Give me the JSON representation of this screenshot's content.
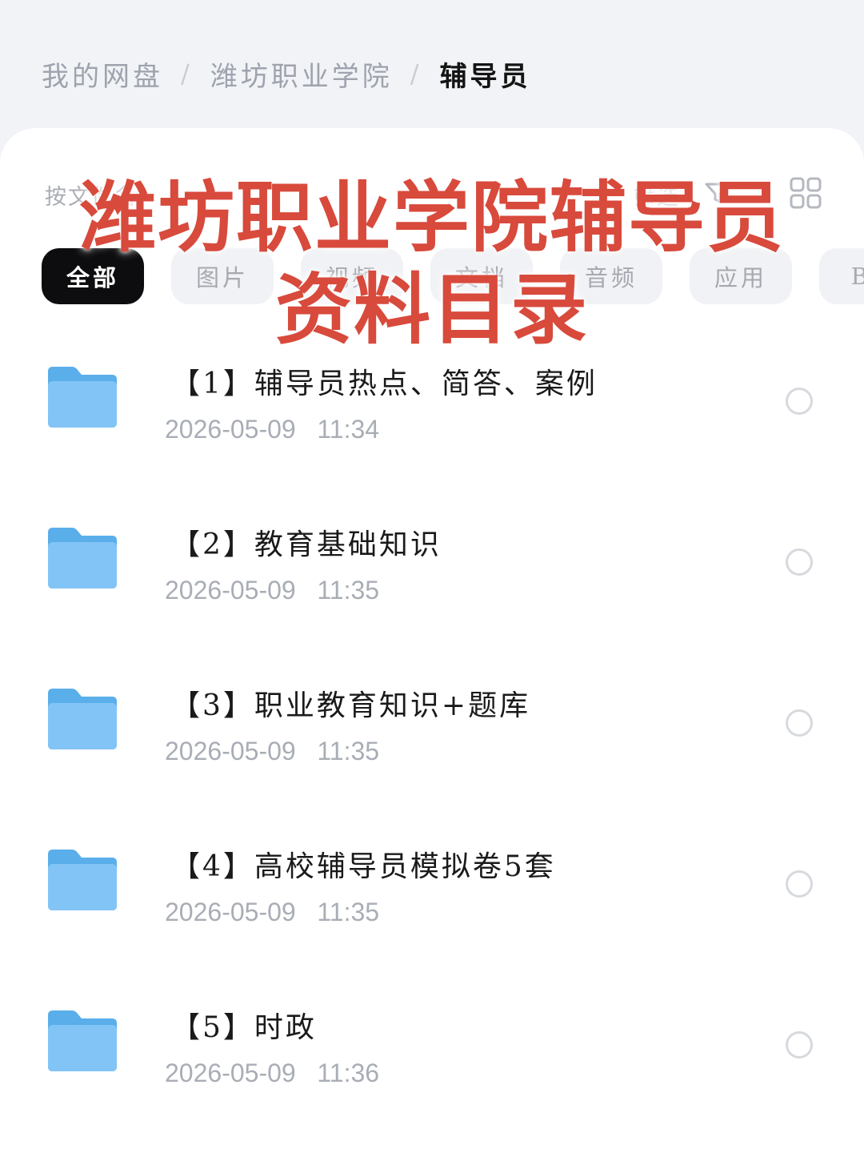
{
  "breadcrumb": {
    "items": [
      "我的网盘",
      "潍坊职业学院",
      "辅导员"
    ],
    "separator": "/"
  },
  "toolbar": {
    "sort_label": "按文件名",
    "filter_label": "筛选"
  },
  "tabs": [
    "全部",
    "图片",
    "视频",
    "文档",
    "音频",
    "应用",
    "BT"
  ],
  "active_tab": "全部",
  "overlay": {
    "line1": "潍坊职业学院辅导员",
    "line2": "资料目录",
    "color": "#d84a3c"
  },
  "files": [
    {
      "name": "【1】辅导员热点、简答、案例",
      "date": "2026-05-09",
      "time": "11:34"
    },
    {
      "name": "【2】教育基础知识",
      "date": "2026-05-09",
      "time": "11:35"
    },
    {
      "name": "【3】职业教育知识+题库",
      "date": "2026-05-09",
      "time": "11:35"
    },
    {
      "name": "【4】高校辅导员模拟卷5套",
      "date": "2026-05-09",
      "time": "11:35"
    },
    {
      "name": "【5】时政",
      "date": "2026-05-09",
      "time": "11:36"
    }
  ],
  "colors": {
    "folder": "#7cc0f4",
    "active_tab_bg": "#0d0d0f"
  }
}
